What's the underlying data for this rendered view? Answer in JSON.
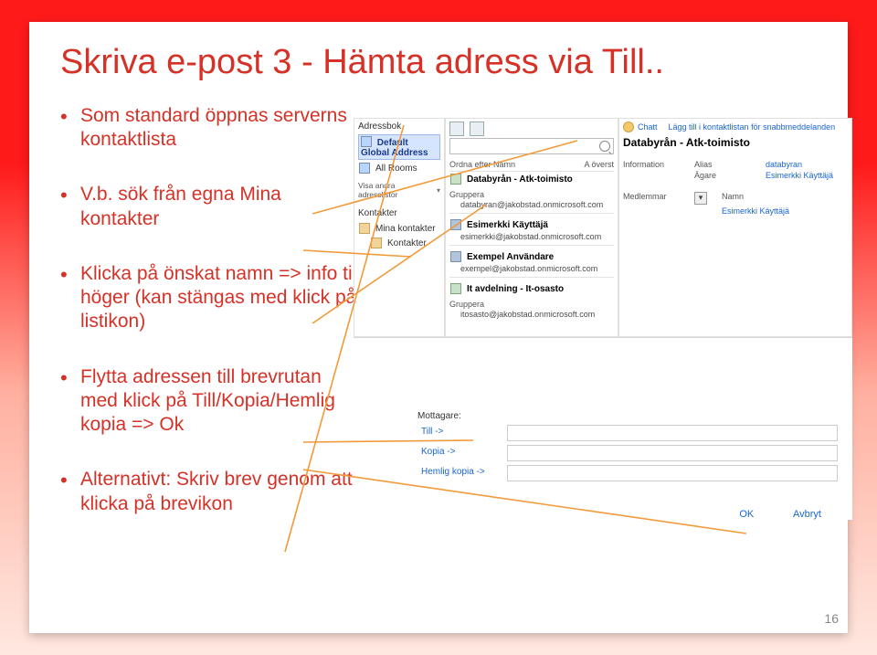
{
  "title": "Skriva e-post 3 - Hämta adress via Till..",
  "bullets": [
    "Som standard öppnas serverns kontaktlista",
    "V.b. sök från egna Mina kontakter",
    "Klicka på önskat namn => info till höger (kan stängas med klick på listikon)",
    "Flytta adressen till brevrutan med klick på Till/Kopia/Hemlig kopia => Ok",
    "Alternativt: Skriv brev genom att klicka på brevikon"
  ],
  "page_number": "16",
  "shot": {
    "col1": {
      "header": "Adressbok",
      "selected": "Default Global Address",
      "all_rooms": "All Rooms",
      "visa": "Visa andra adresslistor",
      "kontakter_header": "Kontakter",
      "mina_kontakter": "Mina kontakter",
      "kontakter": "Kontakter"
    },
    "col2": {
      "sort_label": "Ordna efter Namn",
      "sort_val": "A överst",
      "g1_title": "Databyrån - Atk-toimisto",
      "gruppera": "Gruppera",
      "g1_email": "databyran@jakobstad.onmicrosoft.com",
      "user1": "Esimerkki Käyttäjä",
      "user1_email": "esimerkki@jakobstad.onmicrosoft.com",
      "user2": "Exempel Användare",
      "user2_email": "exempel@jakobstad.onmicrosoft.com",
      "g2_title": "It avdelning - It-osasto",
      "g2_gruppera": "Gruppera",
      "g2_email": "itosasto@jakobstad.onmicrosoft.com"
    },
    "col3": {
      "chat": "Chatt",
      "add_link": "Lägg till i kontaktlistan för snabbmeddelanden",
      "title": "Databyrån - Atk-toimisto",
      "info_hdr": "Information",
      "alias_hdr": "Alias",
      "alias_val": "databyran",
      "owner_hdr": "Ägare",
      "owner_val": "Esimerkki Käyttäjä",
      "members_hdr": "Medlemmar",
      "name_hdr": "Namn",
      "member1": "Esimerkki Käyttäjä"
    },
    "recips": {
      "label": "Mottagare:",
      "to": "Till ->",
      "cc": "Kopia ->",
      "bcc": "Hemlig kopia ->"
    },
    "actions": {
      "ok": "OK",
      "cancel": "Avbryt"
    }
  }
}
